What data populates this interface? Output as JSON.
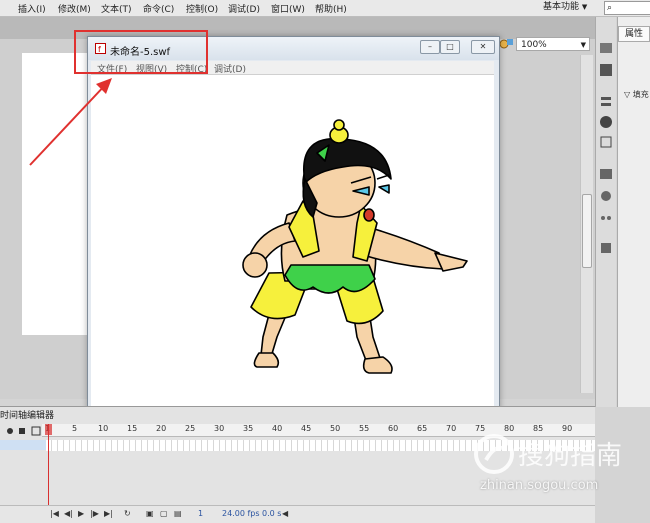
{
  "menubar": {
    "items": [
      "插入(I)",
      "修改(M)",
      "文本(T)",
      "命令(C)",
      "控制(O)",
      "调试(D)",
      "窗口(W)",
      "帮助(H)"
    ],
    "workspace": "基本功能"
  },
  "stage": {
    "zoom": "100%"
  },
  "swf_window": {
    "title": "未命名-5.swf",
    "menu": [
      "文件(F)",
      "视图(V)",
      "控制(C)",
      "调试(D)"
    ]
  },
  "panel": {
    "tab": "属性",
    "fill_label": "填充"
  },
  "timeline": {
    "title": "时间轴编辑器",
    "ruler": [
      "1",
      "5",
      "10",
      "15",
      "20",
      "25",
      "30",
      "35",
      "40",
      "45",
      "50",
      "55",
      "60",
      "65",
      "70",
      "75",
      "80",
      "85",
      "90"
    ],
    "current_frame": "1",
    "fps": "24.00 fps",
    "time": "0.0 s"
  },
  "watermark": {
    "text": "搜狗指南",
    "url": "zhinan.sogou.com"
  },
  "colors": {
    "annotation_red": "#e0312f",
    "skin": "#f6d3a8",
    "pants": "#f6f03c",
    "leaf": "#3fd14a"
  }
}
